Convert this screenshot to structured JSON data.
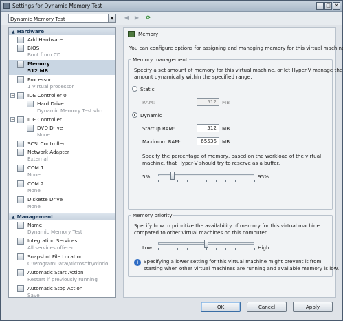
{
  "window": {
    "title": "Settings for Dynamic Memory Test",
    "controls": [
      "_",
      "□",
      "✕"
    ]
  },
  "toolbar": {
    "vm_selected": "Dynamic Memory Test",
    "back_icon": "back-arrow-icon",
    "forward_icon": "forward-arrow-icon",
    "refresh_icon": "refresh-icon"
  },
  "tree": {
    "hardware_header": "Hardware",
    "management_header": "Management",
    "hardware_items": [
      {
        "label": "Add Hardware",
        "sub": "",
        "icon": "add-hardware-icon"
      },
      {
        "label": "BIOS",
        "sub": "Boot from CD",
        "icon": "bios-icon"
      },
      {
        "label": "Memory",
        "sub": "512 MB",
        "icon": "memory-icon",
        "selected": true
      },
      {
        "label": "Processor",
        "sub": "1 Virtual processor",
        "icon": "processor-icon"
      },
      {
        "label": "IDE Controller 0",
        "sub": "",
        "icon": "ide-controller-icon"
      },
      {
        "label": "Hard Drive",
        "sub": "Dynamic Memory Test.vhd",
        "icon": "hard-drive-icon"
      },
      {
        "label": "IDE Controller 1",
        "sub": "",
        "icon": "ide-controller-icon"
      },
      {
        "label": "DVD Drive",
        "sub": "None",
        "icon": "dvd-drive-icon"
      },
      {
        "label": "SCSI Controller",
        "sub": "",
        "icon": "scsi-controller-icon"
      },
      {
        "label": "Network Adapter",
        "sub": "External",
        "icon": "network-adapter-icon"
      },
      {
        "label": "COM 1",
        "sub": "None",
        "icon": "com-port-icon"
      },
      {
        "label": "COM 2",
        "sub": "None",
        "icon": "com-port-icon"
      },
      {
        "label": "Diskette Drive",
        "sub": "None",
        "icon": "diskette-icon"
      }
    ],
    "management_items": [
      {
        "label": "Name",
        "sub": "Dynamic Memory Test",
        "icon": "name-icon"
      },
      {
        "label": "Integration Services",
        "sub": "All services offered",
        "icon": "integration-services-icon"
      },
      {
        "label": "Snapshot File Location",
        "sub": "C:\\ProgramData\\Microsoft\\Windo...",
        "icon": "snapshot-folder-icon"
      },
      {
        "label": "Automatic Start Action",
        "sub": "Restart if previously running",
        "icon": "start-action-icon"
      },
      {
        "label": "Automatic Stop Action",
        "sub": "Save",
        "icon": "stop-action-icon"
      }
    ]
  },
  "panel": {
    "title": "Memory",
    "intro": "You can configure options for assigning and managing memory for this virtual machine.",
    "mm_legend": "Memory management",
    "mm_desc_1": "Specify a set amount of memory for this virtual machine, or let Hyper-V manage the",
    "mm_desc_2": "amount dynamically within the specified range.",
    "static_label": "Static",
    "ram_label": "RAM:",
    "ram_value": "512",
    "mb": "MB",
    "dynamic_label": "Dynamic",
    "startup_label": "Startup RAM:",
    "startup_value": "512",
    "max_label": "Maximum RAM:",
    "max_value": "65536",
    "buffer_desc_1": "Specify the percentage of memory, based on the workload of the virtual",
    "buffer_desc_2": "machine, that Hyper-V should try to reserve as a buffer.",
    "buffer_min": "5%",
    "buffer_max": "95%",
    "buffer_level": 0.15,
    "mp_legend": "Memory priority",
    "mp_desc_1": "Specify how to prioritize the availability of memory for this virtual machine",
    "mp_desc_2": "compared to other virtual machines on this computer.",
    "low": "Low",
    "high": "High",
    "priority_level": 0.5,
    "note_1": "Specifying a lower setting for this virtual machine might prevent it from",
    "note_2": "starting when other virtual machines are running and available memory is low."
  },
  "buttons": {
    "ok": "OK",
    "cancel": "Cancel",
    "apply": "Apply"
  }
}
